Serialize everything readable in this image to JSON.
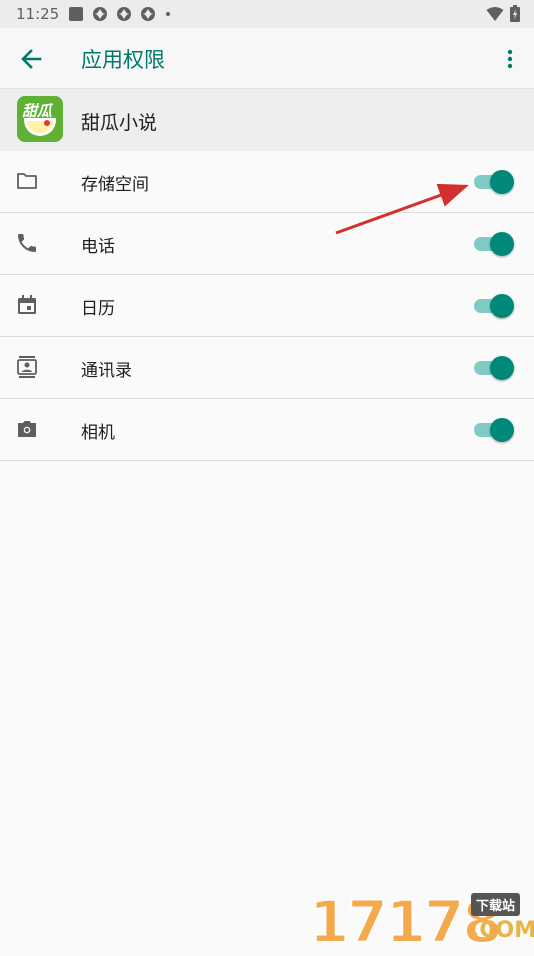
{
  "status_bar": {
    "time": "11:25",
    "notification_icons": [
      "square-notification-icon",
      "app-notification-icon",
      "app-notification-icon",
      "app-notification-icon",
      "dot-icon"
    ],
    "right_icons": [
      "wifi-icon",
      "battery-icon"
    ]
  },
  "toolbar": {
    "back_icon": "arrow-left-icon",
    "title": "应用权限",
    "menu_icon": "more-vert-icon"
  },
  "app": {
    "name": "甜瓜小说",
    "icon_text": "甜瓜",
    "icon_color": "#5fb134"
  },
  "permissions": [
    {
      "label": "存储空间",
      "icon": "folder-icon",
      "enabled": true
    },
    {
      "label": "电话",
      "icon": "phone-icon",
      "enabled": true
    },
    {
      "label": "日历",
      "icon": "calendar-icon",
      "enabled": true
    },
    {
      "label": "通讯录",
      "icon": "contacts-icon",
      "enabled": true
    },
    {
      "label": "相机",
      "icon": "camera-icon",
      "enabled": true
    }
  ],
  "colors": {
    "accent": "#00796b",
    "switch_thumb": "#00897b",
    "switch_track": "#80cbc4",
    "annotation_arrow": "#d32f2f"
  },
  "watermark": {
    "digits": "17178",
    "tag": "下载站",
    "domain": ".COM"
  }
}
